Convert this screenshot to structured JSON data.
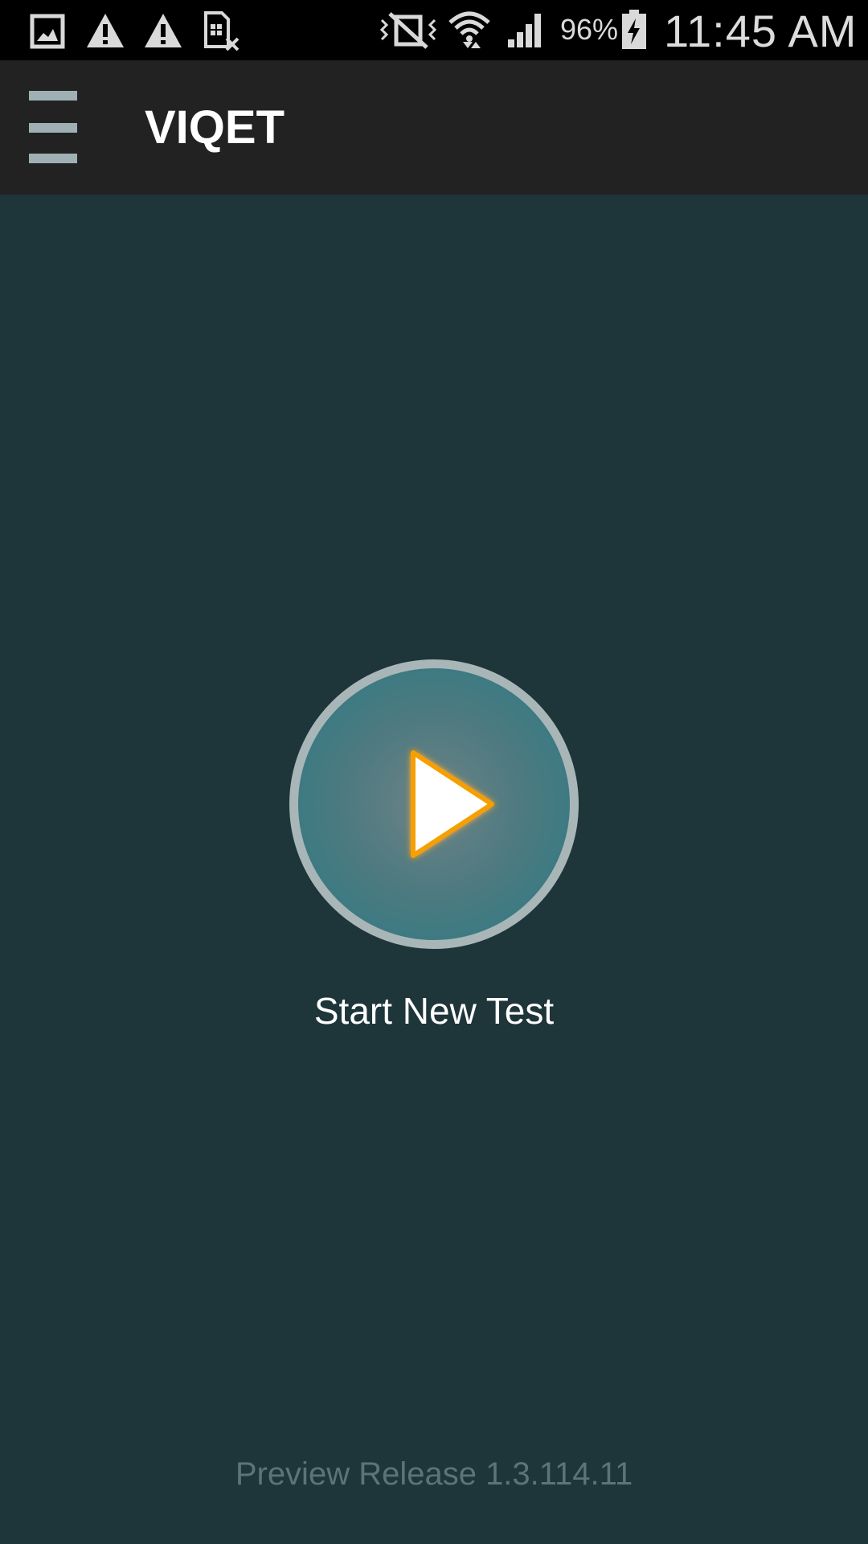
{
  "status_bar": {
    "battery_percent": "96%",
    "time": "11:45 AM",
    "left_icons": [
      "gallery-icon",
      "warning-icon",
      "warning-icon",
      "sim-card-error-icon"
    ],
    "right_icons": [
      "vibrate-off-icon",
      "wifi-icon",
      "signal-icon",
      "battery-charging-icon"
    ]
  },
  "app_bar": {
    "title": "VIQET",
    "menu_icon": "hamburger-menu-icon"
  },
  "main": {
    "start_button_icon": "play-icon",
    "start_label": "Start New Test",
    "version": "Preview Release 1.3.114.11"
  },
  "colors": {
    "background": "#1e353a",
    "app_bar": "#222222",
    "play_accent": "#f5a000",
    "circle_ring": "#a9b6b8"
  }
}
